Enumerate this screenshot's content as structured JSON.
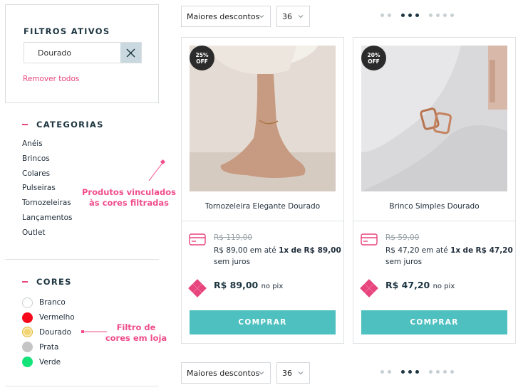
{
  "sidebar": {
    "active_filters": {
      "title": "FILTROS ATIVOS",
      "chip_label": "Dourado",
      "remove_all": "Remover todos"
    },
    "categories": {
      "title": "CATEGORIAS",
      "items": [
        "Anéis",
        "Brincos",
        "Colares",
        "Pulseiras",
        "Tornozeleiras",
        "Lançamentos",
        "Outlet"
      ]
    },
    "colors": {
      "title": "CORES",
      "items": [
        {
          "label": "Branco",
          "color": "#ffffff",
          "border": "#c9cfd3"
        },
        {
          "label": "Vermelho",
          "color": "#f5091a",
          "border": "#f5091a"
        },
        {
          "label": "Dourado",
          "color": "#f2d572",
          "border": "#e2b83a"
        },
        {
          "label": "Prata",
          "color": "#c5c5c5",
          "border": "#c5c5c5"
        },
        {
          "label": "Verde",
          "color": "#14e37a",
          "border": "#14e37a"
        }
      ]
    }
  },
  "annotations": {
    "products_line1": "Produtos vinculados",
    "products_line2": "às cores filtradas",
    "filter_line1": "Filtro de",
    "filter_line2": "cores em loja"
  },
  "toolbar": {
    "sort_value": "Maiores descontos",
    "per_page_value": "36"
  },
  "products": [
    {
      "badge_pct": "25%",
      "badge_off": "OFF",
      "name": "Tornozeleira Elegante Dourado",
      "old_price": "R$ 119,00",
      "price": "R$ 89,00",
      "inst_pre": "em até",
      "inst_count": "1x",
      "inst_de": "de",
      "inst_value": "R$ 89,00",
      "inst_post": "sem juros",
      "pix_price": "R$ 89,00",
      "pix_label": "no pix",
      "buy_label": "COMPRAR"
    },
    {
      "badge_pct": "20%",
      "badge_off": "OFF",
      "name": "Brinco Simples Dourado",
      "old_price": "R$ 59,00",
      "price": "R$ 47,20",
      "inst_pre": "em até",
      "inst_count": "1x",
      "inst_de": "de",
      "inst_value": "R$ 47,20",
      "inst_post": "sem juros",
      "pix_price": "R$ 47,20",
      "pix_label": "no pix",
      "buy_label": "COMPRAR"
    }
  ],
  "colors": {
    "accent_pink": "#e8457e",
    "buy_teal": "#4fc0c0",
    "dark_navy": "#1d3540"
  }
}
